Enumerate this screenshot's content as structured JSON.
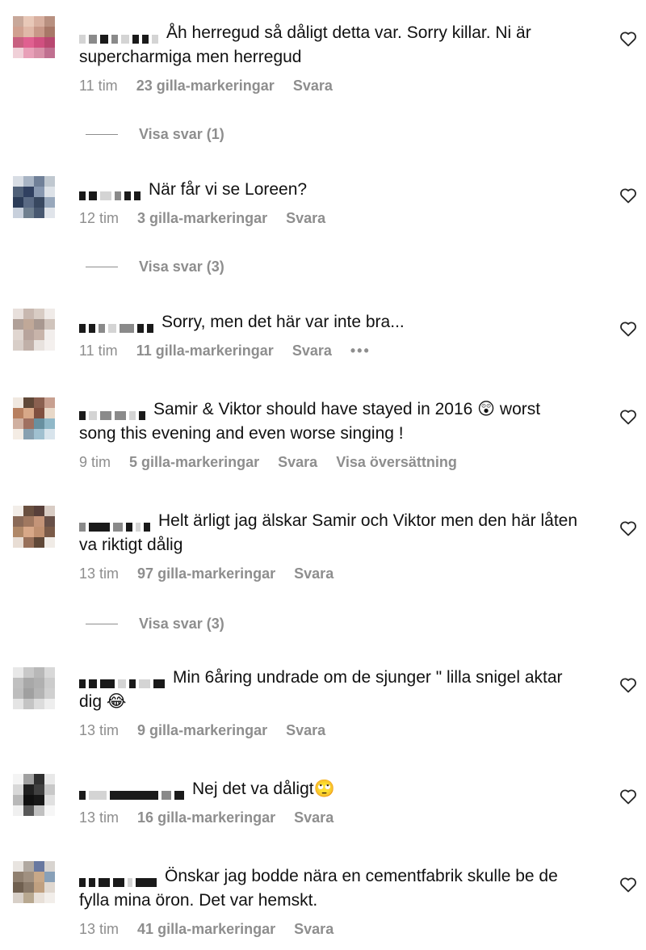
{
  "comments": [
    {
      "text": "Åh herregud så dåligt detta var. Sorry killar. Ni är supercharmiga men herregud",
      "time": "11 tim",
      "likes": "23 gilla-markeringar",
      "reply": "Svara",
      "view_replies": "Visa svar (1)",
      "avatar": [
        "#c8a89a",
        "#e8c8b8",
        "#d8b0a0",
        "#b89080",
        "#d0a090",
        "#e0b8a8",
        "#c89888",
        "#a87868",
        "#c86080",
        "#e06090",
        "#d05080",
        "#b84870",
        "#f0d0d8",
        "#e8a0b8",
        "#d890a8",
        "#c07090"
      ]
    },
    {
      "text": "När får vi se Loreen?",
      "time": "12 tim",
      "likes": "3 gilla-markeringar",
      "reply": "Svara",
      "view_replies": "Visa svar (3)",
      "avatar": [
        "#d8dde4",
        "#a8b4c4",
        "#708098",
        "#c0c8d0",
        "#506078",
        "#304060",
        "#8898b0",
        "#dde2e8",
        "#2c3c58",
        "#5a6a84",
        "#384860",
        "#98a8bc",
        "#c8d0dc",
        "#708090",
        "#485870",
        "#e0e4ea"
      ]
    },
    {
      "text": "Sorry, men det här var inte bra...",
      "time": "11 tim",
      "likes": "11 gilla-markeringar",
      "reply": "Svara",
      "more": "•••",
      "avatar": [
        "#e8e0dc",
        "#c8b8b0",
        "#d8ccc4",
        "#f0ebe8",
        "#b0a098",
        "#c0a898",
        "#a89890",
        "#d0c4bc",
        "#e0d6d0",
        "#b8a49c",
        "#c8b4aa",
        "#f2eeec",
        "#d8cec8",
        "#c0b0a8",
        "#e8e2de",
        "#f4f0ee"
      ]
    },
    {
      "text": "Samir & Viktor should have stayed in 2016 😲 worst song this evening and even worse singing !",
      "time": "9 tim",
      "likes": "5 gilla-markeringar",
      "reply": "Svara",
      "translate": "Visa översättning",
      "avatar": [
        "#f0e8e0",
        "#604838",
        "#8a6050",
        "#c8a090",
        "#b88060",
        "#d8a888",
        "#805040",
        "#e8d8c8",
        "#d0b0a0",
        "#a07060",
        "#6890a0",
        "#90b8c8",
        "#f4ece4",
        "#88a0b0",
        "#a0c0d0",
        "#d8e4ec"
      ]
    },
    {
      "text": "Helt ärligt jag älskar Samir och Viktor men den här låten va riktigt dålig",
      "time": "13 tim",
      "likes": "97 gilla-markeringar",
      "reply": "Svara",
      "view_replies": "Visa svar (3)",
      "avatar": [
        "#f2ede8",
        "#6a5040",
        "#58403a",
        "#d8ccc4",
        "#8a6a58",
        "#a07860",
        "#c49478",
        "#685048",
        "#b08868",
        "#d8a888",
        "#c09070",
        "#7a5a48",
        "#e8ddd4",
        "#98705a",
        "#604838",
        "#f0ebe6"
      ]
    },
    {
      "text": "Min 6åring undrade om de sjunger \" lilla snigel aktar dig 😂",
      "time": "13 tim",
      "likes": "9 gilla-markeringar",
      "reply": "Svara",
      "avatar": [
        "#e8e8e8",
        "#c8c8c8",
        "#b8b8b8",
        "#d8d8d8",
        "#c0c0c0",
        "#a8a8a8",
        "#b0b0b0",
        "#cccccc",
        "#bdbdbd",
        "#a0a0a0",
        "#b4b4b4",
        "#d0d0d0",
        "#e4e4e4",
        "#c4c4c4",
        "#dcdcdc",
        "#eeeeee"
      ]
    },
    {
      "text": "Nej det va dåligt🙄",
      "time": "13 tim",
      "likes": "16 gilla-markeringar",
      "reply": "Svara",
      "avatar": [
        "#f4f4f4",
        "#a0a0a0",
        "#303030",
        "#e8e8e8",
        "#d8d8d8",
        "#202020",
        "#404040",
        "#c8c8c8",
        "#b8b8b8",
        "#101010",
        "#181818",
        "#e0e0e0",
        "#f0f0f0",
        "#585858",
        "#c0c0c0",
        "#f6f6f6"
      ]
    },
    {
      "text": "Önskar jag bodde nära en cementfabrik skulle be de fylla mina öron. Det var hemskt.",
      "time": "13 tim",
      "likes": "41 gilla-markeringar",
      "reply": "Svara",
      "avatar": [
        "#e8e4e0",
        "#b0a8a0",
        "#6878a0",
        "#d8d4d0",
        "#908070",
        "#a09080",
        "#c8a888",
        "#88a0b8",
        "#706050",
        "#8a7a6a",
        "#c0a080",
        "#e0d8d0",
        "#d8d0c8",
        "#b8a890",
        "#e8e0d8",
        "#f2eeea"
      ]
    }
  ]
}
